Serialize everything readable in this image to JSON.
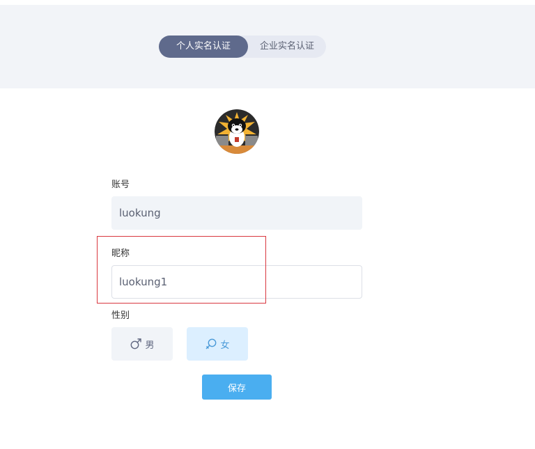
{
  "tabs": {
    "personal": "个人实名认证",
    "enterprise": "企业实名认证"
  },
  "form": {
    "account_label": "账号",
    "account_value": "luokung",
    "nickname_label": "昵称",
    "nickname_value": "luokung1",
    "gender_label": "性别",
    "gender_male": "男",
    "gender_female": "女",
    "gender_selected": "female",
    "save": "保存"
  },
  "colors": {
    "accent": "#4aaef0",
    "tab_active": "#5f6a8c",
    "highlight_box": "#d9363e"
  },
  "icons": {
    "avatar": "dog-avatar-icon",
    "male": "male-symbol-icon",
    "female": "female-symbol-icon"
  }
}
